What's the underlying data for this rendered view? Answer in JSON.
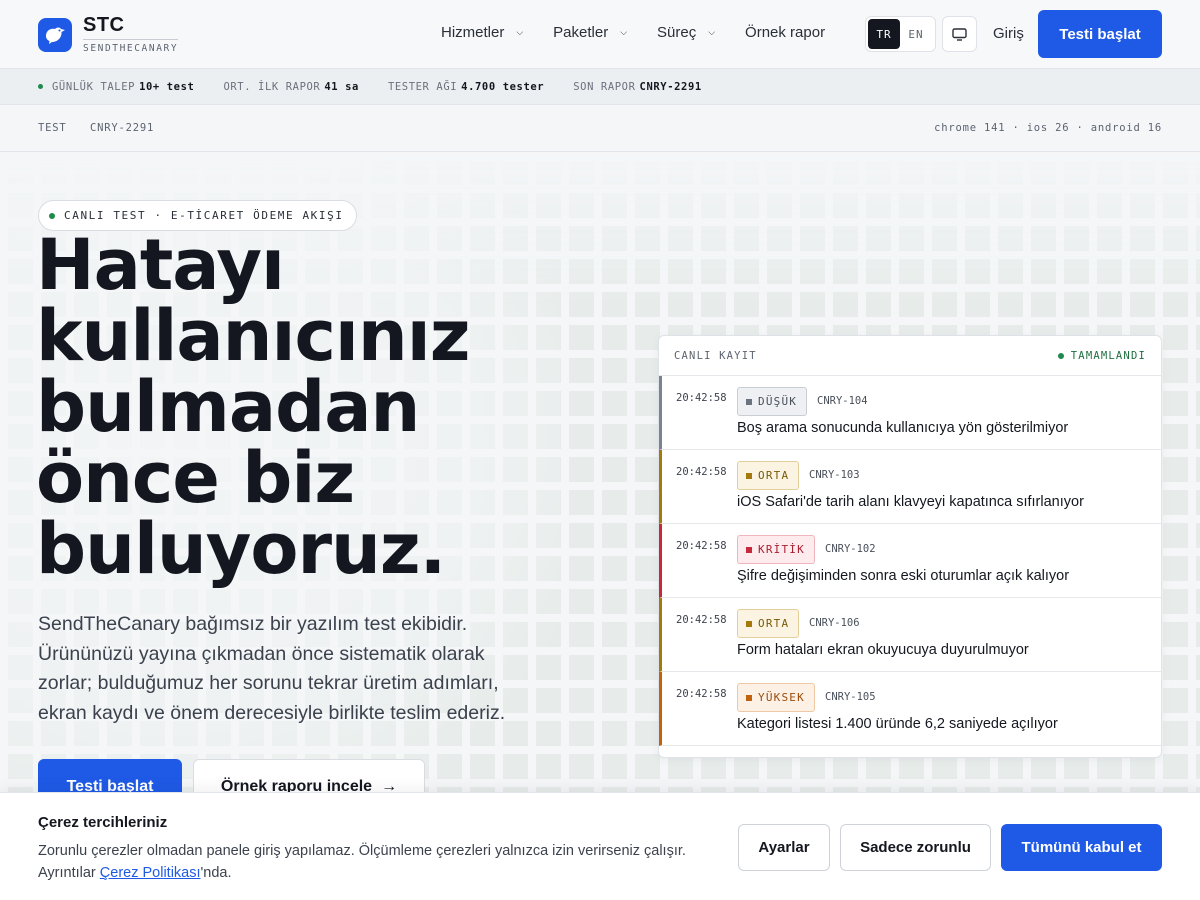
{
  "brand": {
    "name": "STC",
    "tagline": "SENDTHECANARY"
  },
  "nav": {
    "items": [
      {
        "label": "Hizmetler",
        "has_dropdown": true
      },
      {
        "label": "Paketler",
        "has_dropdown": true
      },
      {
        "label": "Süreç",
        "has_dropdown": true
      },
      {
        "label": "Örnek rapor",
        "has_dropdown": false
      }
    ],
    "lang_tr": "TR",
    "lang_en": "EN",
    "login": "Giriş",
    "cta": "Testi başlat"
  },
  "ticker": [
    {
      "key": "GÜNLÜK TALEP",
      "value": "10+ test"
    },
    {
      "key": "ORT. İLK RAPOR",
      "value": "41 sa"
    },
    {
      "key": "TESTER AĞI",
      "value": "4.700 tester"
    },
    {
      "key": "SON RAPOR",
      "value": "CNRY-2291"
    }
  ],
  "testbar": {
    "label": "TEST",
    "id": "CNRY-2291",
    "env": "chrome 141 · ios 26 · android 16"
  },
  "hero": {
    "badge": "CANLI TEST · E-TİCARET ÖDEME AKIŞI",
    "title_lines": [
      "Hatayı",
      "kullanıcınız",
      "bulmadan",
      "önce biz",
      "buluyoruz."
    ],
    "description": "SendTheCanary bağımsız bir yazılım test ekibidir. Ürününüzü yayına çıkmadan önce sistematik olarak zorlar; bulduğumuz her sorunu tekrar üretim adımları, ekran kaydı ve önem derecesiyle birlikte teslim ederiz.",
    "primary_cta": "Testi başlat",
    "secondary_cta": "Örnek raporu incele"
  },
  "log_panel": {
    "title": "CANLI KAYIT",
    "status": "TAMAMLANDI",
    "rows": [
      {
        "time": "20:42:58",
        "severity": "DÜŞÜK",
        "id": "CNRY-104",
        "message": "Boş arama sonucunda kullanıcıya yön gösterilmiyor"
      },
      {
        "time": "20:42:58",
        "severity": "ORTA",
        "id": "CNRY-103",
        "message": "iOS Safari'de tarih alanı klavyeyi kapatınca sıfırlanıyor"
      },
      {
        "time": "20:42:58",
        "severity": "KRİTİK",
        "id": "CNRY-102",
        "message": "Şifre değişiminden sonra eski oturumlar açık kalıyor"
      },
      {
        "time": "20:42:58",
        "severity": "ORTA",
        "id": "CNRY-106",
        "message": "Form hataları ekran okuyucuya duyurulmuyor"
      },
      {
        "time": "20:42:58",
        "severity": "YÜKSEK",
        "id": "CNRY-105",
        "message": "Kategori listesi 1.400 üründe 6,2 saniyede açılıyor"
      }
    ]
  },
  "cookie": {
    "title": "Çerez tercihleriniz",
    "text": "Zorunlu çerezler olmadan panele giriş yapılamaz. Ölçümleme çerezleri yalnızca izin verirseniz çalışır. Ayrıntılar Çerez Politikası'nda.",
    "link": "Çerez Politikası",
    "settings": "Ayarlar",
    "necessary_only": "Sadece zorunlu",
    "accept_all": "Tümünü kabul et"
  },
  "colors": {
    "accent": "#1f5ae6",
    "success": "#1f8a4c",
    "low": "#6b7280",
    "medium": "#a47a0c",
    "critical": "#c8283c",
    "high": "#c2610e"
  }
}
